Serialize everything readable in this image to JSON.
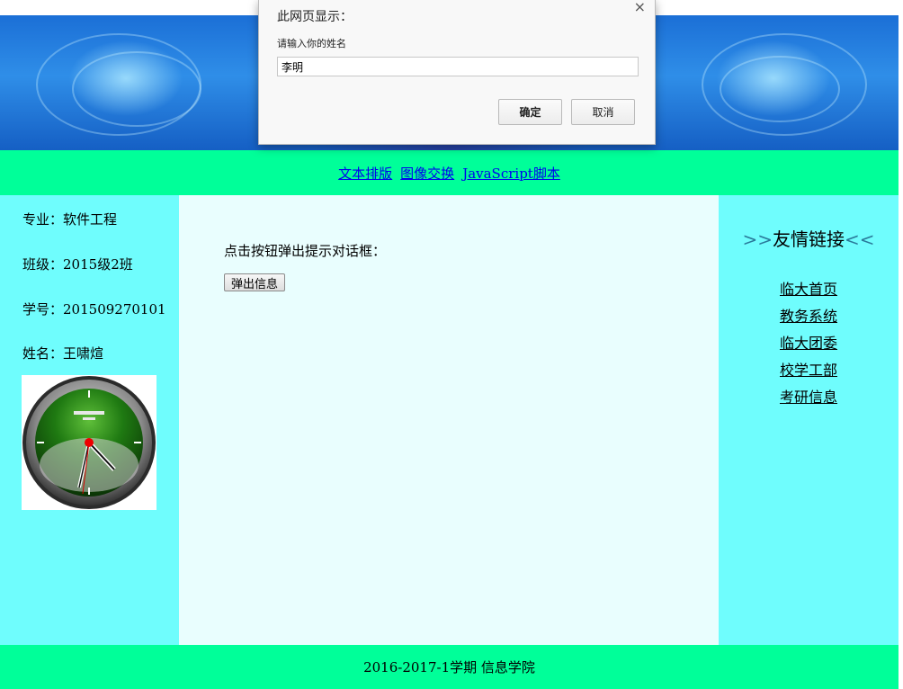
{
  "nav": {
    "links": [
      "文本排版",
      "图像交换",
      "JavaScript脚本"
    ]
  },
  "student": {
    "major_label": "专业：",
    "major": "软件工程",
    "class_label": "班级：",
    "class": "2015级2班",
    "id_label": "学号：",
    "id": "201509270101",
    "name_label": "姓名：",
    "name": "王啸煊"
  },
  "main": {
    "prompt_text": "点击按钮弹出提示对话框：",
    "button_label": "弹出信息"
  },
  "links_panel": {
    "title_prefix": ">>",
    "title": "友情链接",
    "title_suffix": "<<",
    "items": [
      "临大首页",
      "教务系统",
      "临大团委",
      "校学工部",
      "考研信息"
    ]
  },
  "footer": {
    "text": "2016-2017-1学期 信息学院"
  },
  "dialog": {
    "title": "此网页显示：",
    "message": "请输入你的姓名",
    "input_value": "李明",
    "ok_label": "确定",
    "cancel_label": "取消",
    "close_symbol": "×"
  },
  "colors": {
    "nav_bg": "#00ff99",
    "side_bg": "#6ffdfd",
    "center_bg": "#e9fefe",
    "link": "#0000ee"
  },
  "icons": {
    "clock": "analog-clock-icon",
    "close": "close-icon"
  }
}
